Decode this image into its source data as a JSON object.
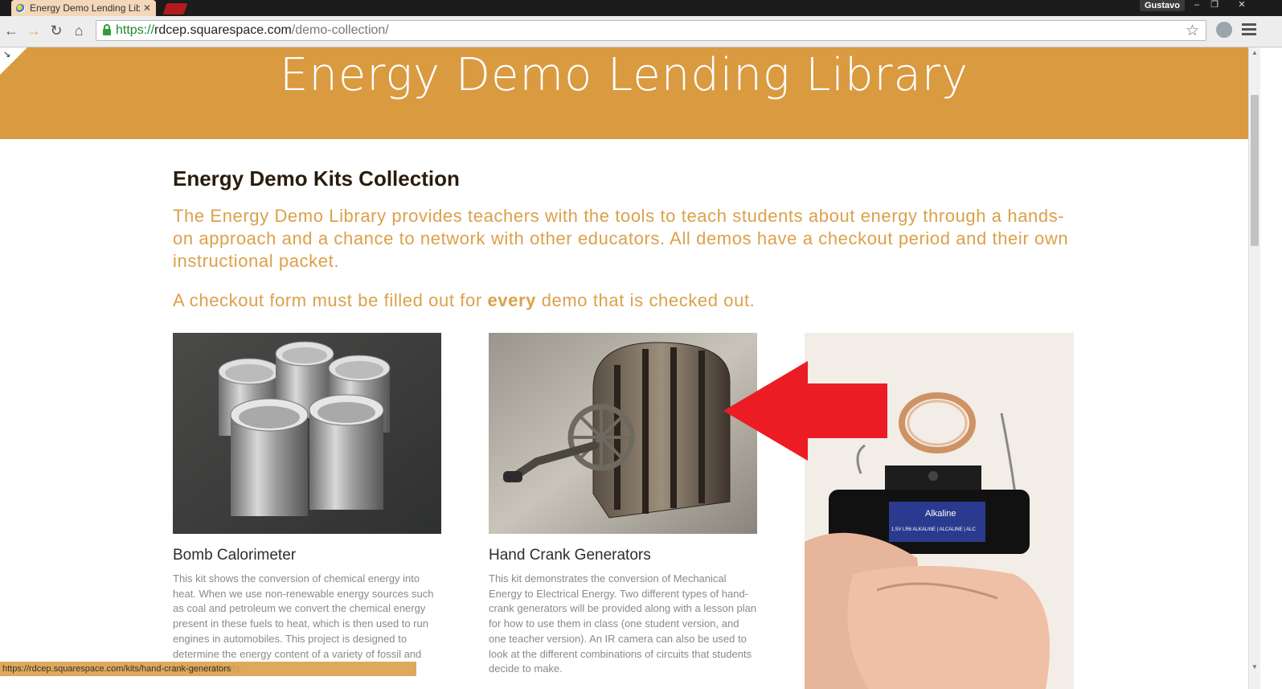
{
  "browser": {
    "tab_title": "Energy Demo Lending Lib",
    "tab_close": "✕",
    "user": "Gustavo",
    "window_controls": [
      "–",
      "❐",
      "✕"
    ],
    "url_scheme": "https://",
    "url_host": "rdcep.squarespace.com",
    "url_path": "/demo-collection/",
    "nav": {
      "back": "←",
      "forward": "→",
      "reload": "↻",
      "home": "⌂"
    },
    "star": "☆"
  },
  "page": {
    "banner_title": "Energy Demo Lending Library",
    "heading": "Energy Demo Kits Collection",
    "intro": "The Energy Demo Library provides teachers with the tools to teach students about energy through a hands-on approach and a chance to network with other educators. All demos have a checkout period and their own instructional packet.",
    "checkout_before": "A checkout form must be filled out for ",
    "checkout_bold": "every",
    "checkout_after": " demo that is checked out.",
    "cards": [
      {
        "title": "Bomb Calorimeter",
        "desc": "This kit shows the conversion of chemical energy into heat. When we use non-renewable energy sources such as coal and petroleum we convert the chemical energy present in these fuels to heat, which is then used to run engines in automobiles. This project is designed to determine the energy content of a variety of fossil and biobased fuels."
      },
      {
        "title": "Hand Crank Generators",
        "desc": "This kit demonstrates the conversion of Mechanical Energy to Electrical Energy. Two different types of hand-crank generators will be provided along with a lesson plan for how to use them in class (one student version, and one teacher version). An IR camera can also be used to look at the different combinations of circuits that students decide to make."
      }
    ],
    "battery_label": "Alkaline",
    "battery_small": "1.5V LR6  ALKALINE | ALCALINE | ALC"
  },
  "status": {
    "hover_url": "https://rdcep.squarespace.com/kits/hand-crank-generators"
  },
  "colors": {
    "banner": "#d99a40",
    "accent_text": "#dca04a",
    "arrow": "#ec1c24"
  }
}
